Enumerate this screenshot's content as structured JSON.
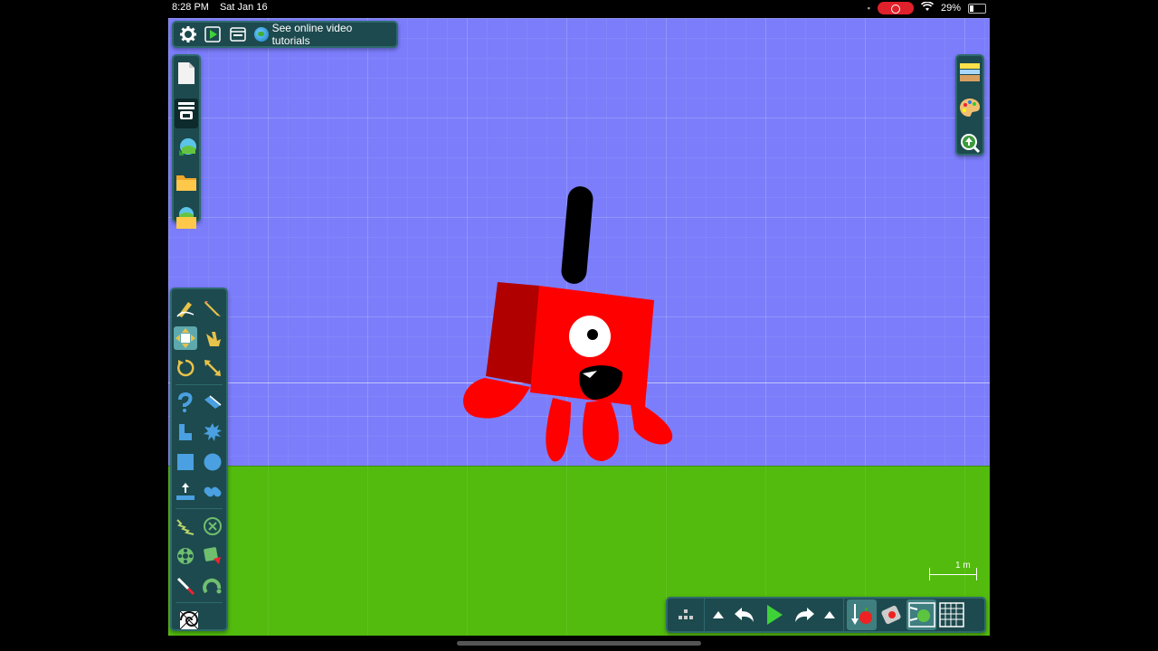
{
  "status_bar": {
    "time": "8:28 PM",
    "date": "Sat Jan 16",
    "battery": "29%",
    "battery_level": 0.29
  },
  "topbar": {
    "tutorials_label": "See online video tutorials",
    "icons": [
      "settings-icon",
      "play-scene-icon",
      "window-icon",
      "globe-icon"
    ]
  },
  "file_panel": {
    "icons": [
      "new-scene-icon",
      "scene-menu-icon",
      "download-scene-icon",
      "open-folder-icon",
      "save-scene-icon"
    ]
  },
  "right_panel": {
    "icons": [
      "background-icon",
      "palette-icon",
      "zoom-icon"
    ]
  },
  "tools": {
    "rows": [
      [
        "draw-icon",
        "pencil-icon"
      ],
      [
        "move-icon",
        "drag-hand-icon"
      ],
      [
        "rotate-icon",
        "scale-icon"
      ],
      [
        "polygon-icon",
        "knife-icon"
      ],
      [
        "brush-icon",
        "gear-shape-icon"
      ],
      [
        "box-icon",
        "circle-icon"
      ],
      [
        "plane-icon",
        "chain-icon"
      ],
      [
        "spring-icon",
        "fixate-icon"
      ],
      [
        "axle-icon",
        "thruster-icon"
      ],
      [
        "laser-icon",
        "hinge-icon"
      ],
      [
        "texture-icon"
      ]
    ],
    "selected": "move-icon"
  },
  "bottombar": {
    "icons": [
      "grid-menu-icon",
      "expand-up-icon",
      "undo-icon",
      "play-icon",
      "redo-icon",
      "expand-up-icon",
      "gravity-icon",
      "air-friction-icon",
      "collision-icon",
      "grid-snap-icon"
    ]
  },
  "scale_indicator": {
    "label": "1 m"
  },
  "colors": {
    "sky": "#7b7dfb",
    "ground": "#52bb0d",
    "character": "#ff0000",
    "panel": "#1d4a4e",
    "selected_tool": "#5ea9ad"
  }
}
